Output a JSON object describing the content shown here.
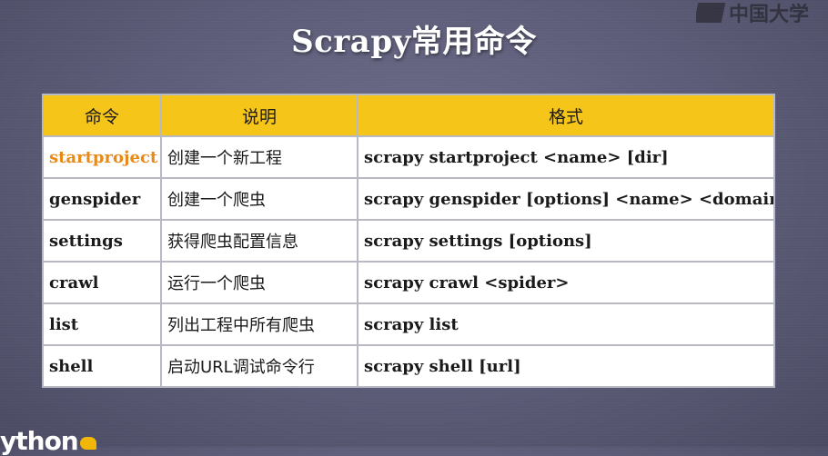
{
  "slide": {
    "title": "Scrapy常用命令",
    "watermark": "中国大学",
    "bottom_logo": "ython"
  },
  "table": {
    "headers": [
      "命令",
      "说明",
      "格式"
    ],
    "rows": [
      {
        "name": "startproject",
        "desc": "创建一个新工程",
        "format": "scrapy startproject <name> [dir]"
      },
      {
        "name": "genspider",
        "desc": "创建一个爬虫",
        "format": "scrapy genspider [options] <name> <domain>"
      },
      {
        "name": "settings",
        "desc": "获得爬虫配置信息",
        "format": "scrapy settings [options]"
      },
      {
        "name": "crawl",
        "desc": "运行一个爬虫",
        "format": "scrapy crawl <spider>"
      },
      {
        "name": "list",
        "desc": "列出工程中所有爬虫",
        "format": "scrapy list"
      },
      {
        "name": "shell",
        "desc": "启动URL调试命令行",
        "format": "scrapy shell [url]"
      }
    ]
  },
  "colors": {
    "header_bg": "#f5c51a",
    "highlight_text": "#e88a1a",
    "background": "#5b5b77"
  }
}
